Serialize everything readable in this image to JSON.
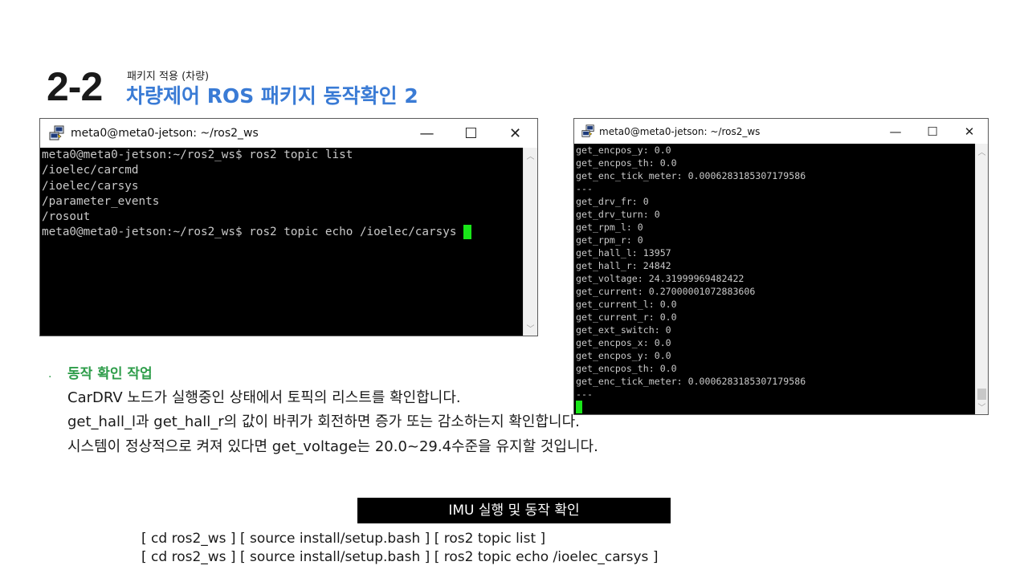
{
  "header": {
    "section_number": "2-2",
    "subtitle": "패키지 적용 (차량)",
    "title": "차량제어 ROS 패키지 동작확인 2"
  },
  "terminal1": {
    "window_title": "meta0@meta0-jetson: ~/ros2_ws",
    "lines": [
      "meta0@meta0-jetson:~/ros2_ws$ ros2 topic list",
      "/ioelec/carcmd",
      "/ioelec/carsys",
      "/parameter_events",
      "/rosout",
      "meta0@meta0-jetson:~/ros2_ws$ ros2 topic echo /ioelec/carsys "
    ]
  },
  "terminal2": {
    "window_title": "meta0@meta0-jetson: ~/ros2_ws",
    "lines": [
      "get_encpos_y: 0.0",
      "get_encpos_th: 0.0",
      "get_enc_tick_meter: 0.0006283185307179586",
      "---",
      "get_drv_fr: 0",
      "get_drv_turn: 0",
      "get_rpm_l: 0",
      "get_rpm_r: 0",
      "get_hall_l: 13957",
      "get_hall_r: 24842",
      "get_voltage: 24.31999969482422",
      "get_current: 0.27000001072883606",
      "get_current_l: 0.0",
      "get_current_r: 0.0",
      "get_ext_switch: 0",
      "get_encpos_x: 0.0",
      "get_encpos_y: 0.0",
      "get_encpos_th: 0.0",
      "get_enc_tick_meter: 0.0006283185307179586",
      "---"
    ]
  },
  "window_buttons": {
    "minimize": "—",
    "maximize": "☐",
    "close": "✕"
  },
  "bullet": {
    "dot": "·",
    "heading": "동작 확인 작업",
    "lines": [
      "CarDRV 노드가 실행중인 상태에서 토픽의 리스트를 확인합니다.",
      "get_hall_l과 get_hall_r의 값이 바퀴가 회전하면 증가 또는 감소하는지 확인합니다.",
      "시스템이 정상적으로 켜져 있다면 get_voltage는 20.0~29.4수준을 유지할 것입니다."
    ]
  },
  "imu": {
    "label": "IMU 실행 및 동작 확인",
    "commands": [
      "[ cd ros2_ws ] [ source install/setup.bash ] [ ros2 topic list ]",
      "[ cd ros2_ws ] [ source install/setup.bash ] [ ros2 topic echo /ioelec_carsys ]"
    ]
  },
  "colors": {
    "title_blue": "#3a7bd5",
    "bullet_green": "#2e9d4a",
    "cursor_green": "#19e619",
    "terminal_bg": "#000000"
  },
  "icons": [
    "putty-icon",
    "minimize-icon",
    "maximize-icon",
    "close-icon",
    "scroll-up-icon",
    "scroll-down-icon"
  ]
}
